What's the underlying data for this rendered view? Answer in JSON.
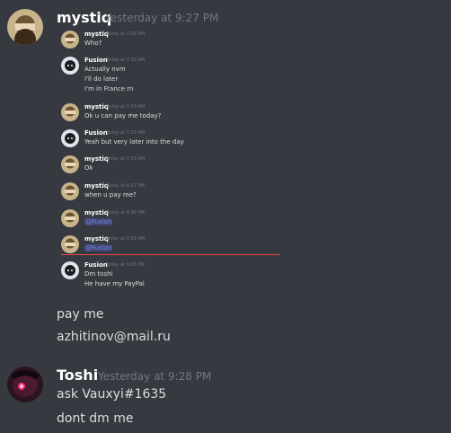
{
  "messages": [
    {
      "author": "mystiq",
      "timestamp": "Yesterday at 9:27 PM",
      "lines": [
        "pay me",
        "azhitinov@mail.ru"
      ]
    },
    {
      "author": "Toshi",
      "timestamp": "Yesterday at 9:28 PM",
      "lines": [
        "ask Vauxyi#1635",
        "dont dm me"
      ]
    }
  ],
  "embedded_screenshot": {
    "messages": [
      {
        "author": "mystiq",
        "timestamp": "Today at 7:28 AM",
        "lines": [
          "Who?"
        ]
      },
      {
        "author": "Fusion",
        "timestamp": "Today at 7:30 AM",
        "lines": [
          "Actually nvm",
          "I'll do later",
          "I'm in France rn"
        ]
      },
      {
        "author": "mystiq",
        "timestamp": "Today at 7:33 AM",
        "lines": [
          "Ok u can pay me today?"
        ]
      },
      {
        "author": "Fusion",
        "timestamp": "Today at 7:33 AM",
        "lines": [
          "Yeah but very later into the day"
        ]
      },
      {
        "author": "mystiq",
        "timestamp": "Today at 7:33 AM",
        "lines": [
          "Ok"
        ]
      },
      {
        "author": "mystiq",
        "timestamp": "Today at 6:27 PM",
        "lines": [
          "when u pay me?"
        ]
      },
      {
        "author": "mystiq",
        "timestamp": "Today at 8:36 PM",
        "lines": [
          "@Fusion"
        ]
      },
      {
        "author": "mystiq",
        "timestamp": "Today at 9:26 AM",
        "lines": [
          "@Fusion"
        ]
      },
      {
        "author": "Fusion",
        "timestamp": "Today at 9:26 PM",
        "lines": [
          "Dm toshi",
          "He have my PayPal"
        ]
      }
    ]
  },
  "colors": {
    "background": "#36393f",
    "author": "#ffffff",
    "timestamp": "#72767d",
    "text": "#dcddde",
    "mention_bg": "#414675",
    "mention_fg": "#7289da",
    "new_messages_divider": "#f04747"
  }
}
